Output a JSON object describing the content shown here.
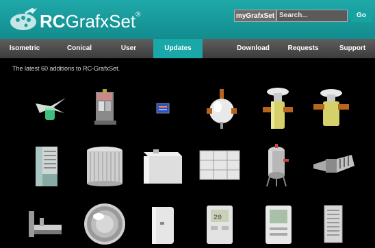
{
  "header": {
    "logo_bold": "RC",
    "logo_rest": "GrafxSet",
    "logo_reg": "®",
    "mygrafxset_label": "myGrafxSet",
    "search_placeholder": "Search...",
    "go_label": "Go"
  },
  "nav": {
    "items": [
      {
        "label": "Isometric"
      },
      {
        "label": "Conical"
      },
      {
        "label": "User"
      },
      {
        "label": "Updates"
      },
      {
        "label": "Download"
      },
      {
        "label": "Requests"
      },
      {
        "label": "Support"
      }
    ],
    "active": "Updates"
  },
  "main": {
    "intro": "The latest 60 additions to RC-GrafxSet."
  },
  "thumbnails": [
    {
      "name": "propeller-valve"
    },
    {
      "name": "electrical-panel"
    },
    {
      "name": "blue-indicator"
    },
    {
      "name": "globe-valve"
    },
    {
      "name": "expansion-valve-vertical"
    },
    {
      "name": "expansion-valve-horizontal"
    },
    {
      "name": "water-tank"
    },
    {
      "name": "cylindrical-tank"
    },
    {
      "name": "rectangular-tank"
    },
    {
      "name": "modular-tank"
    },
    {
      "name": "pressure-vessel"
    },
    {
      "name": "duct-fitting"
    },
    {
      "name": "l-bracket"
    },
    {
      "name": "round-grille"
    },
    {
      "name": "wall-sensor"
    },
    {
      "name": "digital-thermostat"
    },
    {
      "name": "thermostat-display"
    },
    {
      "name": "louvered-grille"
    }
  ],
  "colors": {
    "header": "#1fa8a8",
    "nav": "#4a4a4a",
    "active_tab": "#1aa7a7",
    "background": "#000000"
  }
}
